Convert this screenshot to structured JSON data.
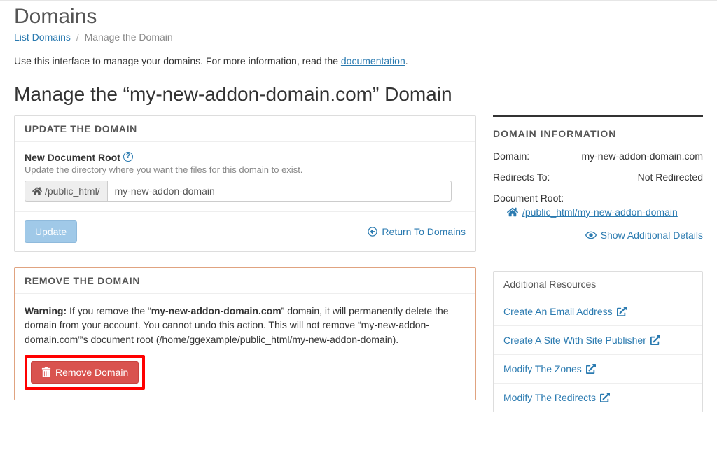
{
  "header": {
    "page_title": "Domains"
  },
  "breadcrumb": {
    "list_link": "List Domains",
    "current": "Manage the Domain"
  },
  "intro": {
    "prefix": "Use this interface to manage your domains. For more information, read the ",
    "link": "documentation",
    "suffix": "."
  },
  "section_heading": "Manage the “my-new-addon-domain.com” Domain",
  "update_panel": {
    "header": "UPDATE THE DOMAIN",
    "field_label": "New Document Root",
    "field_desc": "Update the directory where you want the files for this domain to exist.",
    "prefix": "/public_html/",
    "input_value": "my-new-addon-domain",
    "update_btn": "Update",
    "return_link": "Return To Domains"
  },
  "remove_panel": {
    "header": "REMOVE THE DOMAIN",
    "warning_label": "Warning:",
    "warning_p1": " If you remove the “",
    "domain_bold": "my-new-addon-domain.com",
    "warning_p2": "” domain, it will permanently delete the domain from your account. You cannot undo this action. This will not remove “my-new-addon-domain.com”'s document root (/home/ggexample/public_html/my-new-addon-domain).",
    "remove_btn": "Remove Domain"
  },
  "domain_info": {
    "header": "DOMAIN INFORMATION",
    "domain_label": "Domain:",
    "domain_value": "my-new-addon-domain.com",
    "redirects_label": "Redirects To:",
    "redirects_value": "Not Redirected",
    "docroot_label": "Document Root:",
    "docroot_value": "/public_html/my-new-addon-domain",
    "show_additional": "Show Additional Details"
  },
  "resources": {
    "header": "Additional Resources",
    "items": [
      "Create An Email Address",
      "Create A Site With Site Publisher",
      "Modify The Zones",
      "Modify The Redirects"
    ]
  }
}
